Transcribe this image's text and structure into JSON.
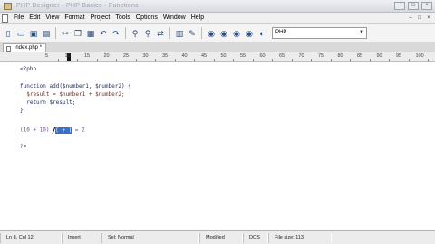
{
  "window": {
    "title": "PHP Designer - PHP Basics - Functions",
    "controls": [
      "–",
      "□",
      "×"
    ]
  },
  "menubar": {
    "items": [
      "File",
      "Edit",
      "View",
      "Format",
      "Project",
      "Tools",
      "Options",
      "Window",
      "Help"
    ],
    "mdi_controls": [
      "–",
      "□",
      "×"
    ]
  },
  "toolbar": {
    "buttons": [
      "new-file-icon",
      "open-file-icon",
      "save-icon",
      "save-all-icon",
      "cut-icon",
      "copy-icon",
      "paste-icon",
      "undo-icon",
      "redo-icon",
      "find-icon",
      "find-next-icon",
      "replace-icon",
      "bookmark-icon",
      "toggle-icon",
      "indent-icon",
      "outdent-icon",
      "comment-icon",
      "uncomment-icon",
      "preview-icon"
    ],
    "language_value": "PHP"
  },
  "tabs": [
    {
      "label": "index.php *"
    }
  ],
  "ruler": {
    "labels": [
      "5",
      "10",
      "15",
      "20",
      "25",
      "30",
      "35",
      "40",
      "45",
      "50",
      "55",
      "60",
      "65",
      "70",
      "75",
      "80",
      "85",
      "90",
      "95",
      "100"
    ]
  },
  "editor": {
    "lines": [
      {
        "text": "<?php"
      },
      {
        "text": ""
      },
      {
        "text": "function add($number1, $number2) {"
      },
      {
        "text": "  $result = $number1 + $number2;"
      },
      {
        "text": "  return $result;"
      },
      {
        "text": "}"
      },
      {
        "text": ""
      },
      {
        "text_before": "(10 + 10) ",
        "selected": "( + )",
        "text_after": " = 2"
      },
      {
        "text": ""
      },
      {
        "text": "?>"
      }
    ]
  },
  "status": {
    "position": "Ln 8, Col 12",
    "mode": "Insert",
    "sel": "Sel: Normal",
    "modified": "Modified",
    "format": "DOS",
    "filesize": "File size: 113"
  }
}
